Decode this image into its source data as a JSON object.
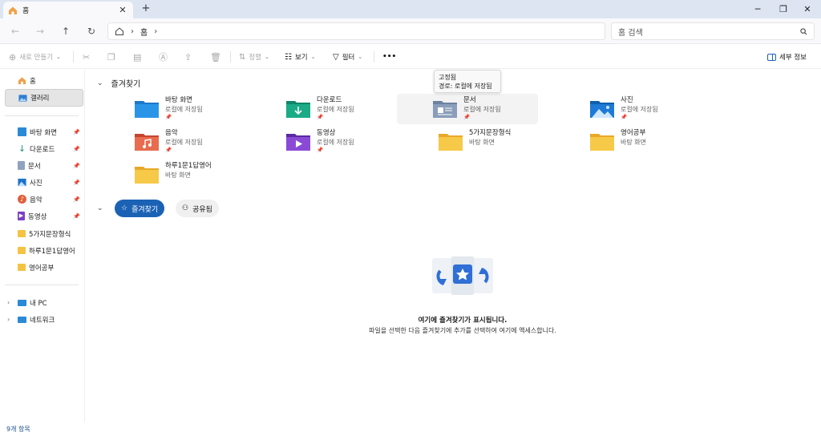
{
  "window": {
    "tab_title": "홈",
    "new_tab": "+",
    "minimize": "─",
    "maximize": "❐",
    "close": "✕"
  },
  "nav": {
    "back": "←",
    "forward": "→",
    "up": "↑",
    "refresh": "↻",
    "breadcrumb": [
      "홈"
    ],
    "search_placeholder": "홈 검색"
  },
  "commands": {
    "new": "새로 만들기",
    "sort": "정렬",
    "view": "보기",
    "filter": "필터",
    "more": "•••",
    "details": "세부 정보"
  },
  "sidebar": {
    "top": [
      {
        "label": "홈",
        "icon": "home-icon",
        "selected": false
      },
      {
        "label": "갤러리",
        "icon": "gallery-icon",
        "selected": true
      }
    ],
    "quick": [
      {
        "label": "바탕 화면",
        "icon": "desktop-icon",
        "pinned": true
      },
      {
        "label": "다운로드",
        "icon": "download-icon",
        "pinned": true
      },
      {
        "label": "문서",
        "icon": "document-icon",
        "pinned": true
      },
      {
        "label": "사진",
        "icon": "pictures-icon",
        "pinned": true
      },
      {
        "label": "음악",
        "icon": "music-icon",
        "pinned": true
      },
      {
        "label": "동영상",
        "icon": "video-icon",
        "pinned": true
      },
      {
        "label": "5가지문장형식",
        "icon": "folder-icon",
        "pinned": false
      },
      {
        "label": "하루1문1답영어",
        "icon": "folder-icon",
        "pinned": false
      },
      {
        "label": "영어공부",
        "icon": "folder-icon",
        "pinned": false
      }
    ],
    "devices": [
      {
        "label": "내 PC",
        "icon": "pc-icon"
      },
      {
        "label": "네트워크",
        "icon": "network-icon"
      }
    ]
  },
  "main": {
    "quick_access_title": "즐겨찾기",
    "tiles": [
      {
        "name": "바탕 화면",
        "sub": "로컬에 저장됨",
        "pinned": true,
        "icon": "desktop-folder-icon"
      },
      {
        "name": "다운로드",
        "sub": "로컬에 저장됨",
        "pinned": true,
        "icon": "download-folder-icon"
      },
      {
        "name": "문서",
        "sub": "로컬에 저장됨",
        "pinned": true,
        "icon": "document-folder-icon"
      },
      {
        "name": "사진",
        "sub": "로컬에 저장됨",
        "pinned": true,
        "icon": "pictures-folder-icon"
      },
      {
        "name": "음악",
        "sub": "로컬에 저장됨",
        "pinned": true,
        "icon": "music-folder-icon"
      },
      {
        "name": "동영상",
        "sub": "로컬에 저장됨",
        "pinned": true,
        "icon": "video-folder-icon"
      },
      {
        "name": "5가지문장형식",
        "sub": "바탕 화면",
        "pinned": false,
        "icon": "folder-icon"
      },
      {
        "name": "영어공부",
        "sub": "바탕 화면",
        "pinned": false,
        "icon": "folder-icon"
      },
      {
        "name": "하루1문1답영어",
        "sub": "바탕 화면",
        "pinned": false,
        "icon": "folder-icon"
      }
    ],
    "pin_glyph": "📌",
    "tooltip": {
      "line1": "고정됨",
      "line2": "경로: 로컬에 저장됨"
    },
    "tabs": [
      {
        "label": "즐겨찾기",
        "active": true
      },
      {
        "label": "공유됨",
        "active": false
      }
    ],
    "empty_title": "여기에 즐겨찾기가 표시됩니다.",
    "empty_desc": "파일을 선택한 다음 즐겨찾기에 추가를 선택하여 여기에 액세스합니다."
  },
  "status": {
    "count": "9개 항목"
  },
  "colors": {
    "accent": "#1b62b5",
    "folder_yellow": "#f5c342",
    "selected_bg": "#e5e5e5"
  }
}
